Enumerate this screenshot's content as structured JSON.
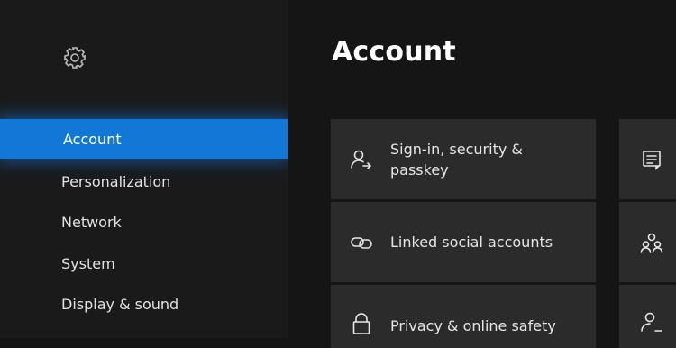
{
  "sidebar": {
    "settings_icon": "gear-icon",
    "items": [
      {
        "label": "Account",
        "selected": true
      },
      {
        "label": "Personalization",
        "selected": false
      },
      {
        "label": "Network",
        "selected": false
      },
      {
        "label": "System",
        "selected": false
      },
      {
        "label": "Display & sound",
        "selected": false
      }
    ]
  },
  "main": {
    "title": "Account",
    "tiles": [
      {
        "label": "Sign-in, security & passkey",
        "icon": "person-arrow-icon"
      },
      {
        "label": "Linked social accounts",
        "icon": "link-icon"
      },
      {
        "label": "Privacy & online safety",
        "icon": "lock-icon"
      }
    ],
    "side_tiles": [
      {
        "icon": "list-document-icon"
      },
      {
        "icon": "people-group-icon"
      },
      {
        "icon": "person-edit-icon"
      }
    ]
  },
  "colors": {
    "accent": "#1278d8",
    "background": "#151515",
    "sidebar": "#1a1a1a",
    "tile": "#2b2b2b",
    "text": "#e9e9e9"
  }
}
